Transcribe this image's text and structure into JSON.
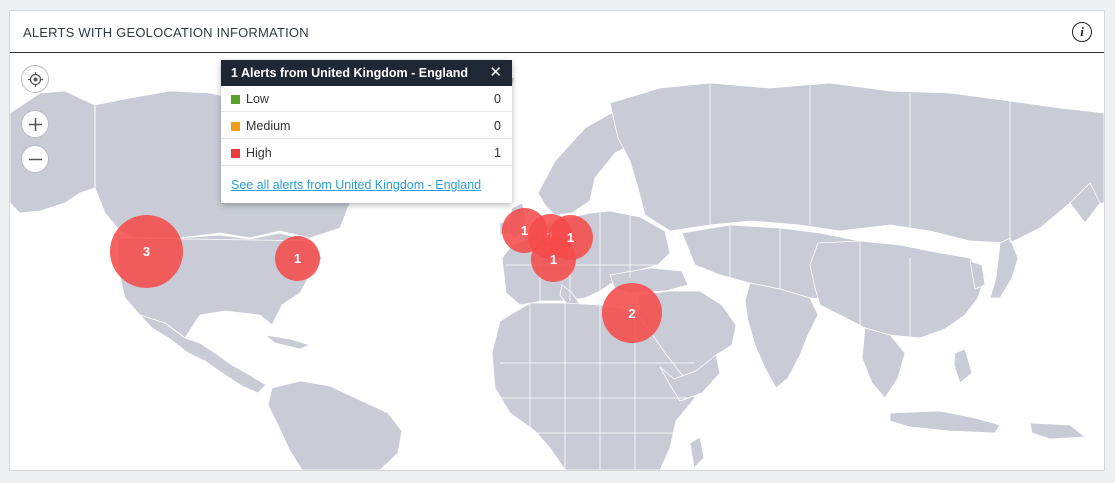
{
  "panel": {
    "title": "ALERTS WITH GEOLOCATION INFORMATION",
    "info_icon": "info-icon",
    "info_glyph": "i"
  },
  "map": {
    "controls": [
      {
        "name": "locate-button",
        "icon": "crosshair-icon"
      },
      {
        "name": "zoom-in-button",
        "icon": "plus-icon"
      },
      {
        "name": "zoom-out-button",
        "icon": "minus-icon"
      }
    ],
    "land_color": "#c9ccd6",
    "border_color": "#ffffff",
    "cluster_color": "#f54b4b",
    "clusters": [
      {
        "count": "3",
        "region": "US West Coast"
      },
      {
        "count": "1",
        "region": "US Northeast"
      },
      {
        "count": "1",
        "region": "United Kingdom - England"
      },
      {
        "count": "1",
        "region": "Western Europe"
      },
      {
        "count": "1",
        "region": "Central Europe"
      },
      {
        "count": "1",
        "region": "Southern Europe"
      },
      {
        "count": "2",
        "region": "Middle East"
      }
    ]
  },
  "popup": {
    "title": "1 Alerts from United Kingdom - England",
    "close_glyph": "✕",
    "rows": [
      {
        "label": "Low",
        "count": "0",
        "color": "#5aa02c"
      },
      {
        "label": "Medium",
        "count": "0",
        "color": "#f29c11"
      },
      {
        "label": "High",
        "count": "1",
        "color": "#ec3b3b"
      }
    ],
    "link": "See all alerts from United Kingdom - England"
  }
}
